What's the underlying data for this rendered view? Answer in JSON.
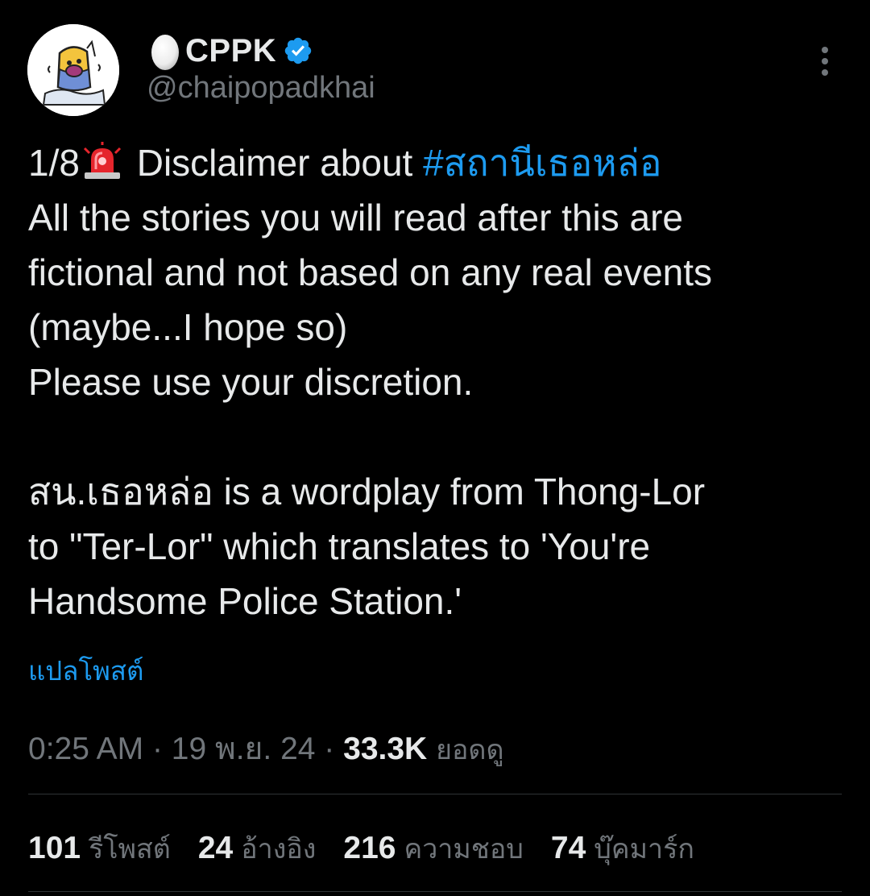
{
  "author": {
    "display_name": "CPPK",
    "handle": "@chaipopadkhai",
    "verified": true,
    "name_emoji": "egg-icon",
    "avatar": "avatar"
  },
  "tweet": {
    "lines": [
      {
        "prefix": "1/8",
        "emoji": "siren-icon",
        "text": " Disclaimer about ",
        "hashtag": "#สถานีเธอหล่อ"
      },
      {
        "text": "All the stories you will read after this are"
      },
      {
        "text": "fictional and not based on any real events"
      },
      {
        "text": "(maybe...I hope so)"
      },
      {
        "text": "Please use your discretion."
      },
      {
        "text": ""
      },
      {
        "text": "สน.เธอหล่อ is a wordplay from Thong-Lor"
      },
      {
        "text": "to \"Ter-Lor\" which translates to 'You're"
      },
      {
        "text": "Handsome Police Station.'"
      }
    ],
    "translate_label": "แปลโพสต์"
  },
  "meta": {
    "time": "0:25 AM",
    "separator": "·",
    "date": "19 พ.ย. 24",
    "views_count": "33.3K",
    "views_label": "ยอดดู"
  },
  "stats": [
    {
      "count": "101",
      "label": "รีโพสต์"
    },
    {
      "count": "24",
      "label": "อ้างอิง"
    },
    {
      "count": "216",
      "label": "ความชอบ"
    },
    {
      "count": "74",
      "label": "บุ๊คมาร์ก"
    }
  ],
  "colors": {
    "background": "#000000",
    "text": "#e7e9ea",
    "secondary": "#71767b",
    "accent": "#1d9bf0",
    "divider": "#2f3336"
  }
}
